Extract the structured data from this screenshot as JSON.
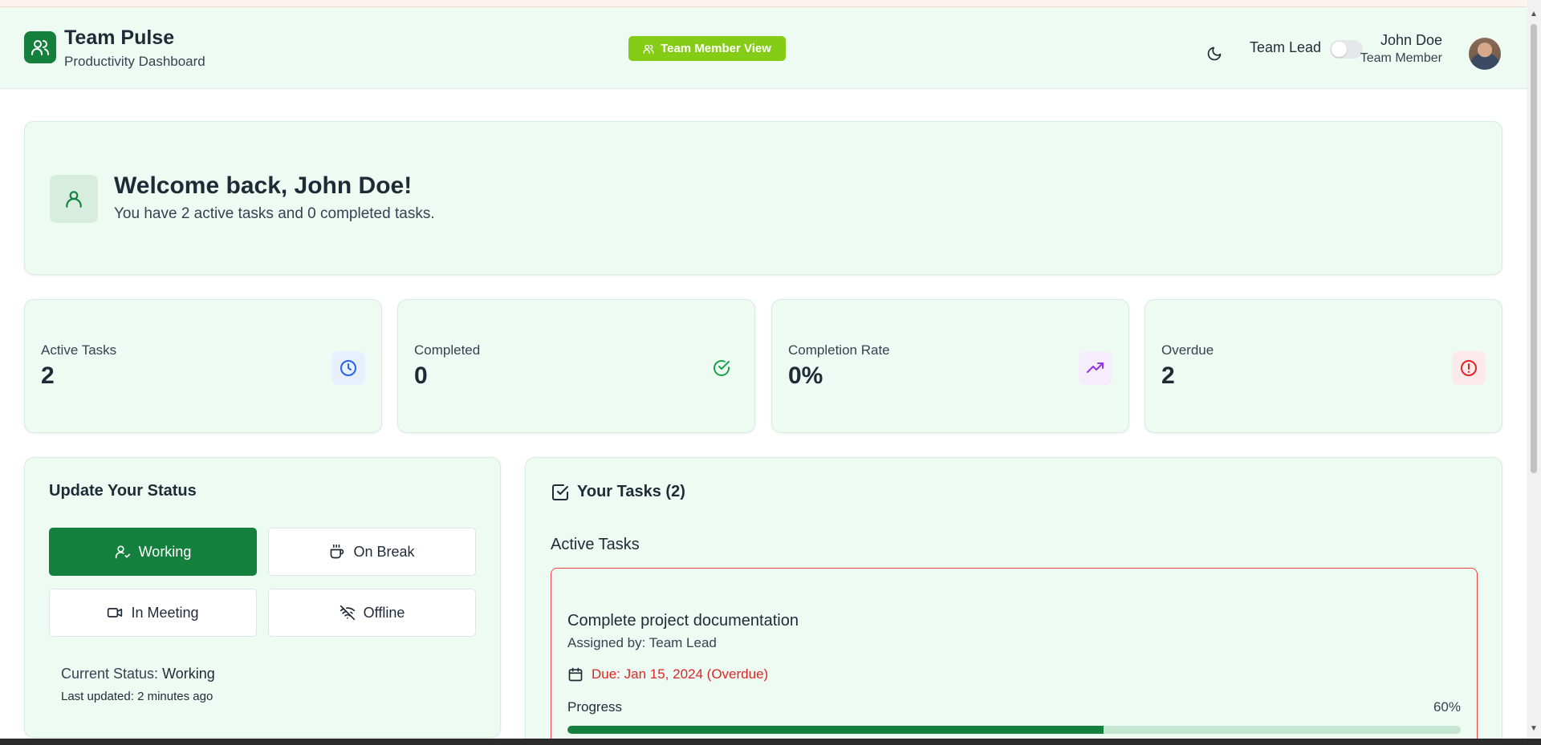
{
  "header": {
    "app_title": "Team Pulse",
    "app_subtitle": "Productivity Dashboard",
    "view_badge": "Team Member View",
    "toggle_label": "Team Lead",
    "toggle_on": false,
    "user_name": "John Doe",
    "user_role": "Team Member"
  },
  "welcome": {
    "title": "Welcome back, John Doe!",
    "subtitle": "You have 2 active tasks and 0 completed tasks."
  },
  "stats": [
    {
      "label": "Active Tasks",
      "value": "2",
      "icon": "clock-icon",
      "color": "#2563eb",
      "bg": "#e8efff"
    },
    {
      "label": "Completed",
      "value": "0",
      "icon": "check-circle-icon",
      "color": "#16a34a",
      "bg": "#eefbf3"
    },
    {
      "label": "Completion Rate",
      "value": "0%",
      "icon": "trending-up-icon",
      "color": "#9333ea",
      "bg": "#f5edfb"
    },
    {
      "label": "Overdue",
      "value": "2",
      "icon": "alert-circle-icon",
      "color": "#dc2626",
      "bg": "#fce9ec"
    }
  ],
  "status": {
    "title": "Update Your Status",
    "buttons": [
      {
        "label": "Working",
        "icon": "user-check-icon",
        "active": true
      },
      {
        "label": "On Break",
        "icon": "coffee-icon",
        "active": false
      },
      {
        "label": "In Meeting",
        "icon": "video-icon",
        "active": false
      },
      {
        "label": "Offline",
        "icon": "wifi-off-icon",
        "active": false
      }
    ],
    "current_label": "Current Status:",
    "current_value": "Working",
    "last_updated": "Last updated: 2 minutes ago"
  },
  "tasks": {
    "title": "Your Tasks (2)",
    "section": "Active Tasks",
    "items": [
      {
        "title": "Complete project documentation",
        "assigned": "Assigned by: Team Lead",
        "due": "Due: Jan 15, 2024 (Overdue)",
        "progress_label": "Progress",
        "progress_text": "60%",
        "progress": 0.6
      }
    ]
  },
  "colors": {
    "brand": "#15803d",
    "badge": "#84cc16",
    "overdue": "#dc2626"
  }
}
